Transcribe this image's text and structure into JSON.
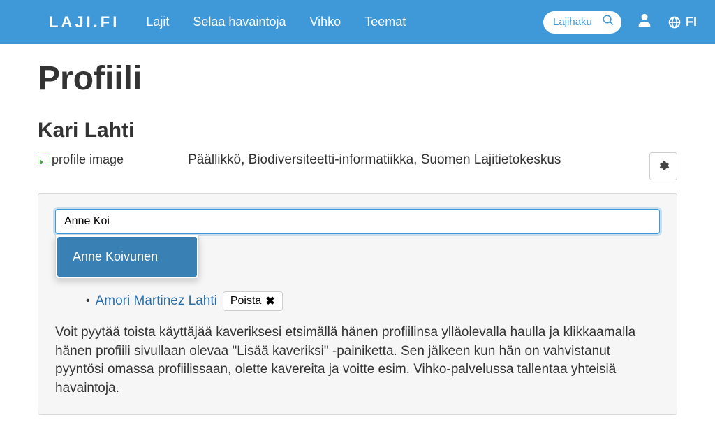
{
  "navbar": {
    "brand": "LAJI.FI",
    "links": [
      "Lajit",
      "Selaa havaintoja",
      "Vihko",
      "Teemat"
    ],
    "search_placeholder": "Lajihaku",
    "language": "FI"
  },
  "page": {
    "title": "Profiili",
    "user_name": "Kari Lahti",
    "image_alt": "profile image",
    "role": "Päällikkö, Biodiversiteetti-informatiikka, Suomen Lajitietokeskus"
  },
  "friends": {
    "search_value": "Anne Koi",
    "suggestion": "Anne Koivunen",
    "existing": {
      "name": "Amori Martinez Lahti",
      "remove_label": "Poista"
    },
    "help": "Voit pyytää toista käyttäjää kaveriksesi etsimällä hänen profiilinsa ylläolevalla haulla ja klikkaamalla hänen profiili sivullaan olevaa \"Lisää kaveriksi\" -painiketta. Sen jälkeen kun hän on vahvistanut pyyntösi omassa profiilissaan, olette kavereita ja voitte esim. Vihko-palvelussa tallentaa yhteisiä havaintoja."
  }
}
